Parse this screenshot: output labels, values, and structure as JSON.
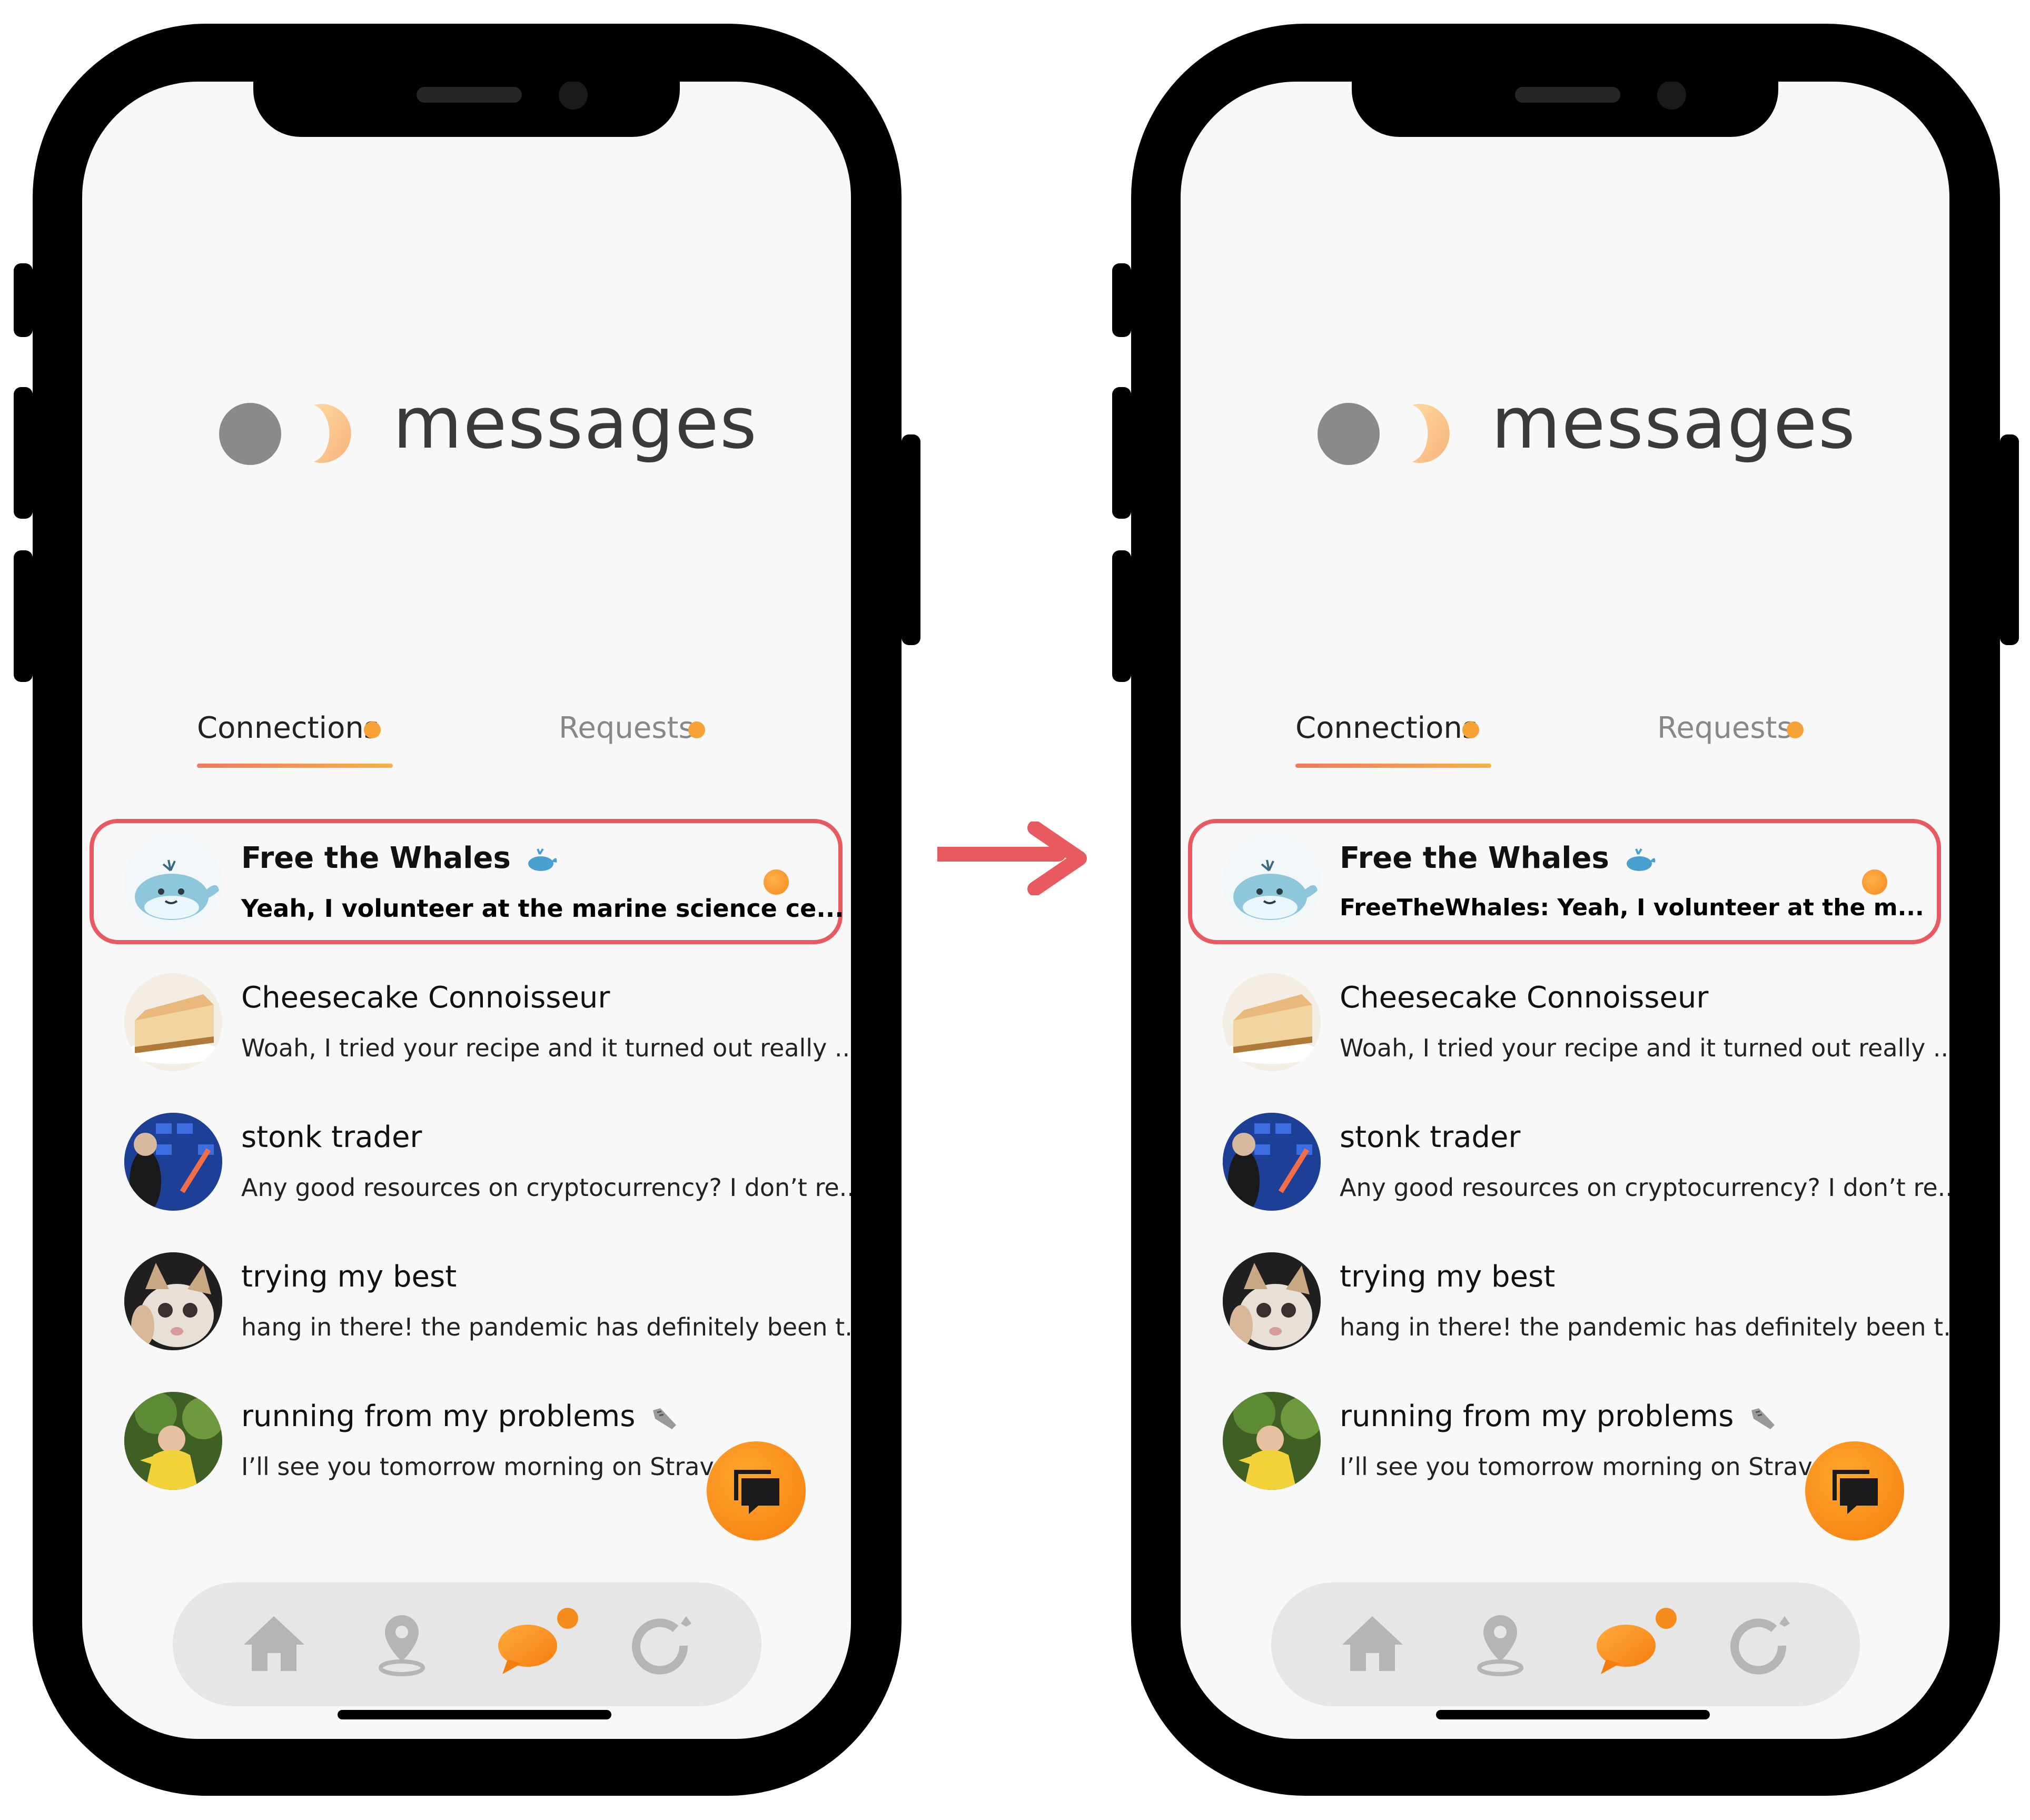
{
  "screens": [
    {
      "id": "before",
      "title": "messages",
      "tabs": [
        {
          "label": "Connections",
          "active": true,
          "has_dot": true
        },
        {
          "label": "Requests",
          "active": false,
          "has_dot": true
        }
      ],
      "conversations": [
        {
          "name": "Free the Whales",
          "name_emoji": "whale",
          "message": "Yeah, I volunteer at the marine science ce...",
          "unread": true,
          "bold": true,
          "highlighted": true,
          "avatar": "whale"
        },
        {
          "name": "Cheesecake Connoisseur",
          "message": "Woah, I tried your recipe and it turned out really ...",
          "unread": false,
          "avatar": "cheesecake"
        },
        {
          "name": "stonk trader",
          "message": "Any good resources on cryptocurrency? I don’t re...",
          "unread": false,
          "avatar": "stonks"
        },
        {
          "name": "trying my best",
          "message": "hang in there! the pandemic has definitely been t...",
          "unread": false,
          "avatar": "cat"
        },
        {
          "name": "running from my problems",
          "name_emoji": "sneaker",
          "message": "I’ll see you tomorrow morning on Strava ah",
          "unread": false,
          "avatar": "runner"
        }
      ]
    },
    {
      "id": "after",
      "title": "messages",
      "tabs": [
        {
          "label": "Connections",
          "active": true,
          "has_dot": true
        },
        {
          "label": "Requests",
          "active": false,
          "has_dot": true
        }
      ],
      "conversations": [
        {
          "name": "Free the Whales",
          "name_emoji": "whale",
          "message": "FreeTheWhales: Yeah, I volunteer at the m...",
          "unread": true,
          "bold": true,
          "highlighted": true,
          "avatar": "whale"
        },
        {
          "name": "Cheesecake Connoisseur",
          "message": "Woah, I tried your recipe and it turned out really ...",
          "unread": false,
          "avatar": "cheesecake"
        },
        {
          "name": "stonk trader",
          "message": "Any good resources on cryptocurrency? I don’t re...",
          "unread": false,
          "avatar": "stonks"
        },
        {
          "name": "trying my best",
          "message": "hang in there! the pandemic has definitely been t...",
          "unread": false,
          "avatar": "cat"
        },
        {
          "name": "running from my problems",
          "name_emoji": "sneaker",
          "message": "I’ll see you tomorrow morning on Strava ah",
          "unread": false,
          "avatar": "runner"
        }
      ]
    }
  ],
  "nav": {
    "items": [
      {
        "icon": "home-icon",
        "active": false
      },
      {
        "icon": "map-pin-icon",
        "active": false
      },
      {
        "icon": "chat-bubble-icon",
        "active": true,
        "badge": true
      },
      {
        "icon": "circle-flower-icon",
        "active": false
      }
    ]
  },
  "fab_icon": "new-chat-icon",
  "colors": {
    "accent": "#f58b1d",
    "highlight_border": "#e85a5f",
    "arrow": "#e85a5f",
    "screen_bg": "#f8f8f8",
    "nav_bg": "#e6e6e6"
  }
}
